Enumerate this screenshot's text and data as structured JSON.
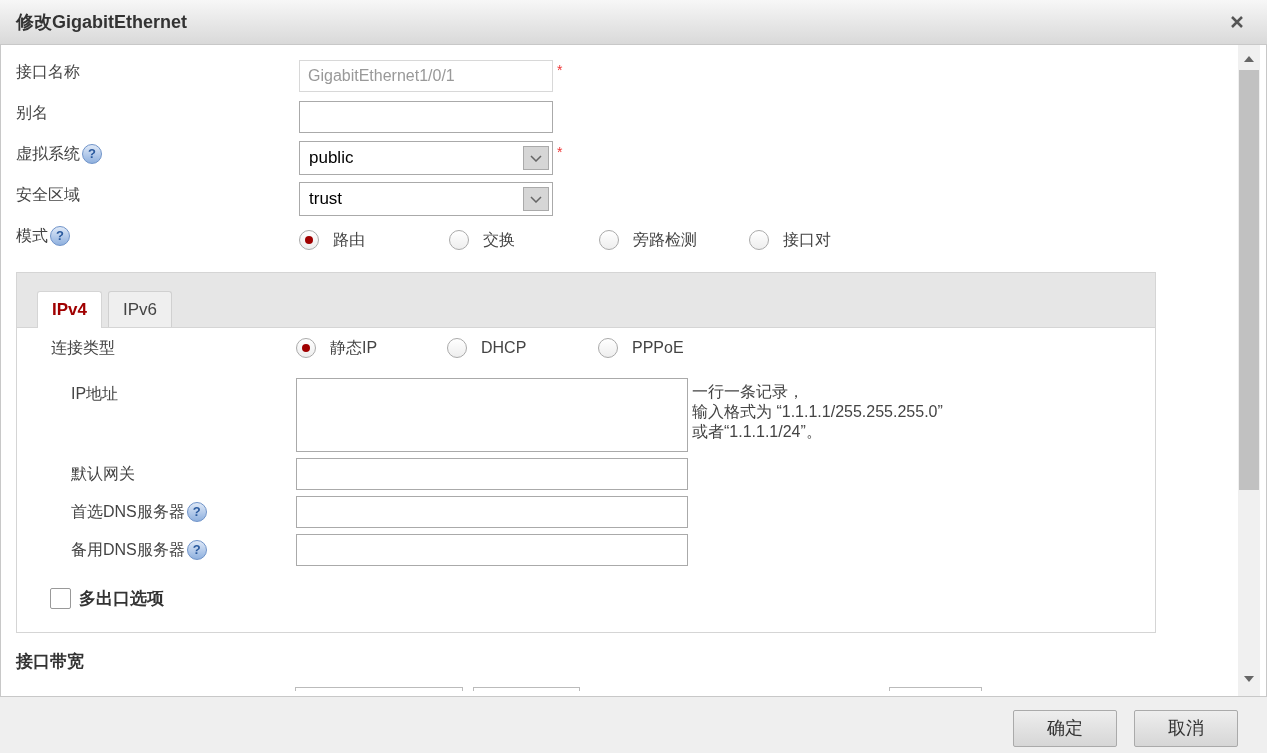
{
  "window": {
    "title": "修改GigabitEthernet"
  },
  "fields": [
    {
      "kind": "text",
      "label": "接口名称",
      "value": "GigabitEthernet1/0/1",
      "disabled": true,
      "marker": "*"
    },
    {
      "kind": "text",
      "label": "别名",
      "disabled": false
    },
    {
      "kind": "select",
      "label": "虚拟系统",
      "help": "?",
      "value": "public",
      "marker": "*"
    },
    {
      "kind": "select",
      "label": "安全区域",
      "value": "trust"
    },
    {
      "kind": "radio",
      "label": "模式",
      "help": "?",
      "options": [
        {
          "label": "路由",
          "selected": true
        },
        {
          "label": "交换",
          "selected": false
        },
        {
          "label": "旁路检测",
          "selected": false
        },
        {
          "label": "接口对",
          "selected": false
        }
      ]
    }
  ],
  "tabs": [
    {
      "label": "IPv4",
      "selected": true
    },
    {
      "label": "IPv6",
      "selected": false
    }
  ],
  "connection_type": {
    "label": "连接类型",
    "options": [
      {
        "label": "静态IP",
        "selected": true
      },
      {
        "label": "DHCP",
        "selected": false
      },
      {
        "label": "PPPoE",
        "selected": false
      }
    ]
  },
  "ip_fields": [
    {
      "kind": "textarea",
      "label": "IP地址",
      "hint_lines": [
        "一行一条记录，",
        "输入格式为 “1.1.1.1/255.255.255.0”",
        "或者“1.1.1.1/24”。"
      ]
    },
    {
      "kind": "text",
      "label": "默认网关"
    },
    {
      "kind": "text",
      "label": "首选DNS服务器",
      "help": "?"
    },
    {
      "kind": "text",
      "label": "备用DNS服务器",
      "help": "?"
    }
  ],
  "multi_exit": {
    "label": "多出口选项",
    "checked": false
  },
  "section_title": "接口带宽",
  "buttons": [
    "确定",
    "取消"
  ]
}
